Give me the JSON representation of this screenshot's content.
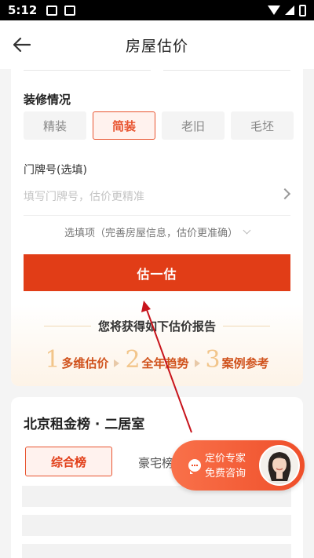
{
  "status_bar": {
    "time": "5:12"
  },
  "header": {
    "title": "房屋估价"
  },
  "decoration": {
    "label": "装修情况",
    "options": [
      "精装",
      "简装",
      "老旧",
      "毛坯"
    ],
    "selected": "简装"
  },
  "door_number": {
    "label": "门牌号(选填)",
    "placeholder": "填写门牌号，估价更精准"
  },
  "optional_toggle": "选填项（完善房屋信息，估价更准确）",
  "estimate_button": "估一估",
  "report": {
    "title": "您将获得如下估价报告",
    "steps": [
      {
        "num": "1",
        "text": "多维估价"
      },
      {
        "num": "2",
        "text": "全年趋势"
      },
      {
        "num": "3",
        "text": "案例参考"
      }
    ]
  },
  "ranking": {
    "title": "北京租金榜 · 二居室",
    "tabs": [
      "综合榜",
      "豪宅榜"
    ]
  },
  "expert": {
    "line1": "定价专家",
    "line2": "免费咨询"
  },
  "colors": {
    "accent": "#e13d17",
    "accent_light": "#fff2ee",
    "gold": "#f2c58a"
  }
}
